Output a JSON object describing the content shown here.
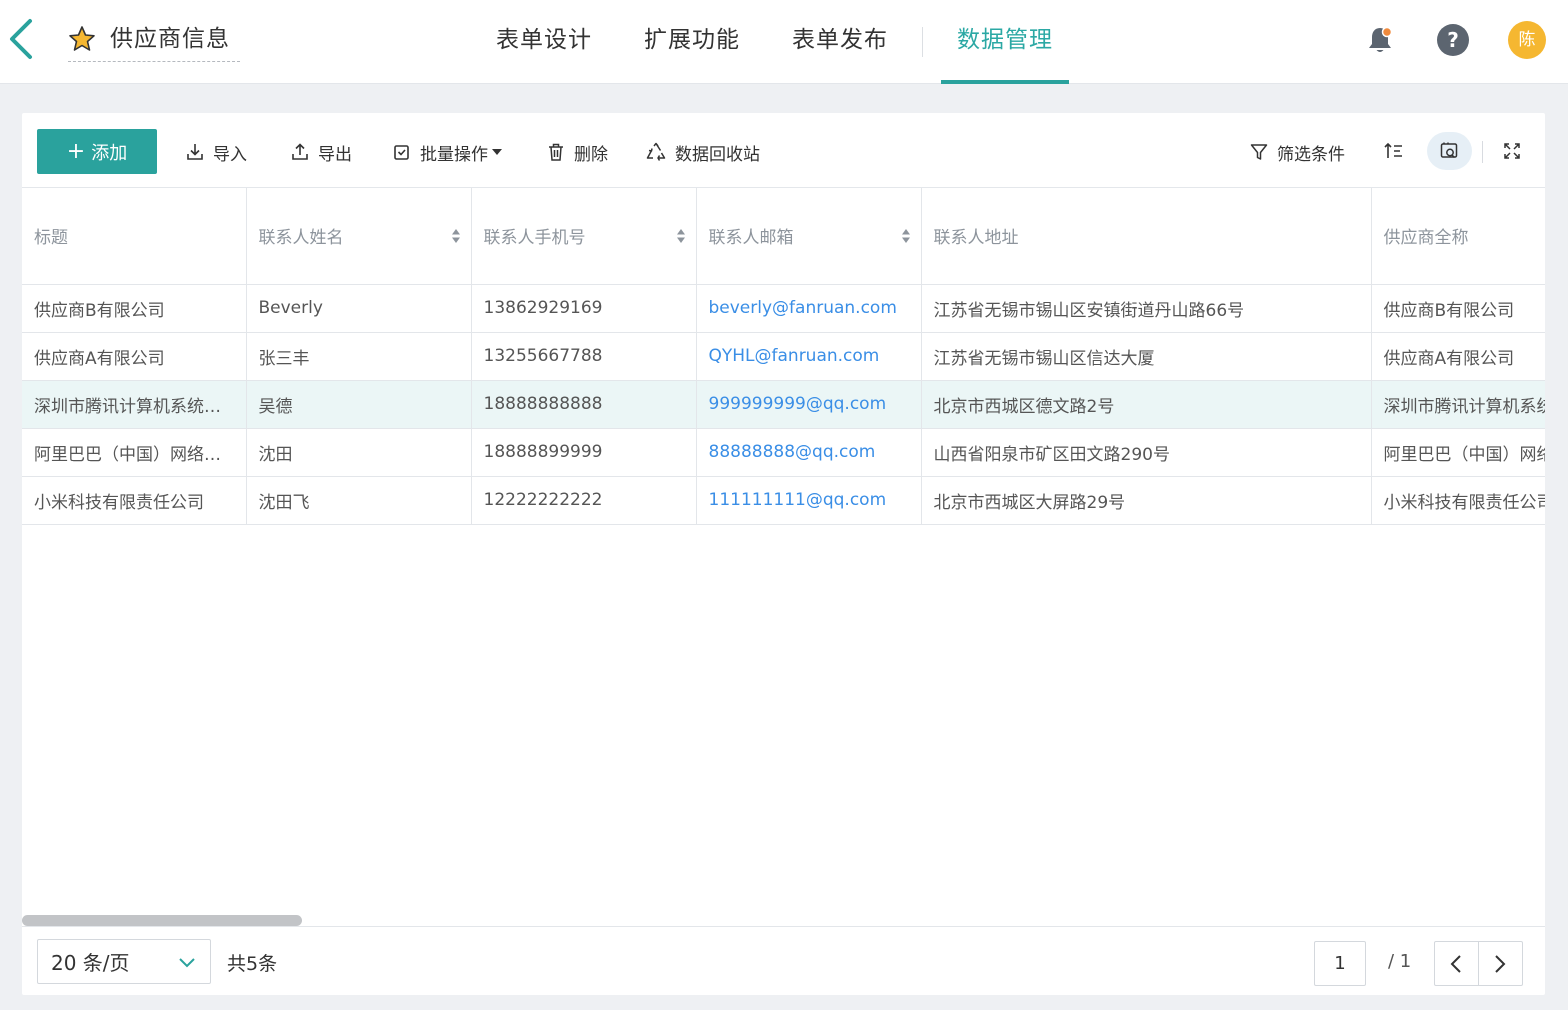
{
  "header": {
    "app_title": "供应商信息",
    "tabs": [
      {
        "label": "表单设计"
      },
      {
        "label": "扩展功能"
      },
      {
        "label": "表单发布"
      },
      {
        "label": "数据管理",
        "active": true
      }
    ],
    "avatar_text": "陈",
    "help_text": "?",
    "accent_color": "#2aa29d",
    "avatar_color": "#f5b731"
  },
  "toolbar": {
    "add_label": "添加",
    "import_label": "导入",
    "export_label": "导出",
    "batch_label": "批量操作",
    "delete_label": "删除",
    "recycle_label": "数据回收站",
    "filter_label": "筛选条件"
  },
  "table": {
    "columns": [
      "标题",
      "联系人姓名",
      "联系人手机号",
      "联系人邮箱",
      "联系人地址",
      "供应商全称"
    ],
    "rows": [
      [
        "供应商B有限公司",
        "Beverly",
        "13862929169",
        "beverly@fanruan.com",
        "江苏省无锡市锡山区安镇街道丹山路66号",
        "供应商B有限公司"
      ],
      [
        "供应商A有限公司",
        "张三丰",
        "13255667788",
        "QYHL@fanruan.com",
        "江苏省无锡市锡山区信达大厦",
        "供应商A有限公司"
      ],
      [
        "深圳市腾讯计算机系统有限公司",
        "吴德",
        "18888888888",
        "999999999@qq.com",
        "北京市西城区德文路2号",
        "深圳市腾讯计算机系统有限公司"
      ],
      [
        "阿里巴巴（中国）网络技术有限公司",
        "沈田",
        "18888899999",
        "88888888@qq.com",
        "山西省阳泉市矿区田文路290号",
        "阿里巴巴（中国）网络技术有限公司"
      ],
      [
        "小米科技有限责任公司",
        "沈田飞",
        "12222222222",
        "111111111@qq.com",
        "北京市西城区大屏路29号",
        "小米科技有限责任公司"
      ]
    ],
    "highlighted_row": 2
  },
  "footer": {
    "page_size": "20 条/页",
    "total": "共5条",
    "current_page": "1",
    "total_pages": "/ 1"
  }
}
